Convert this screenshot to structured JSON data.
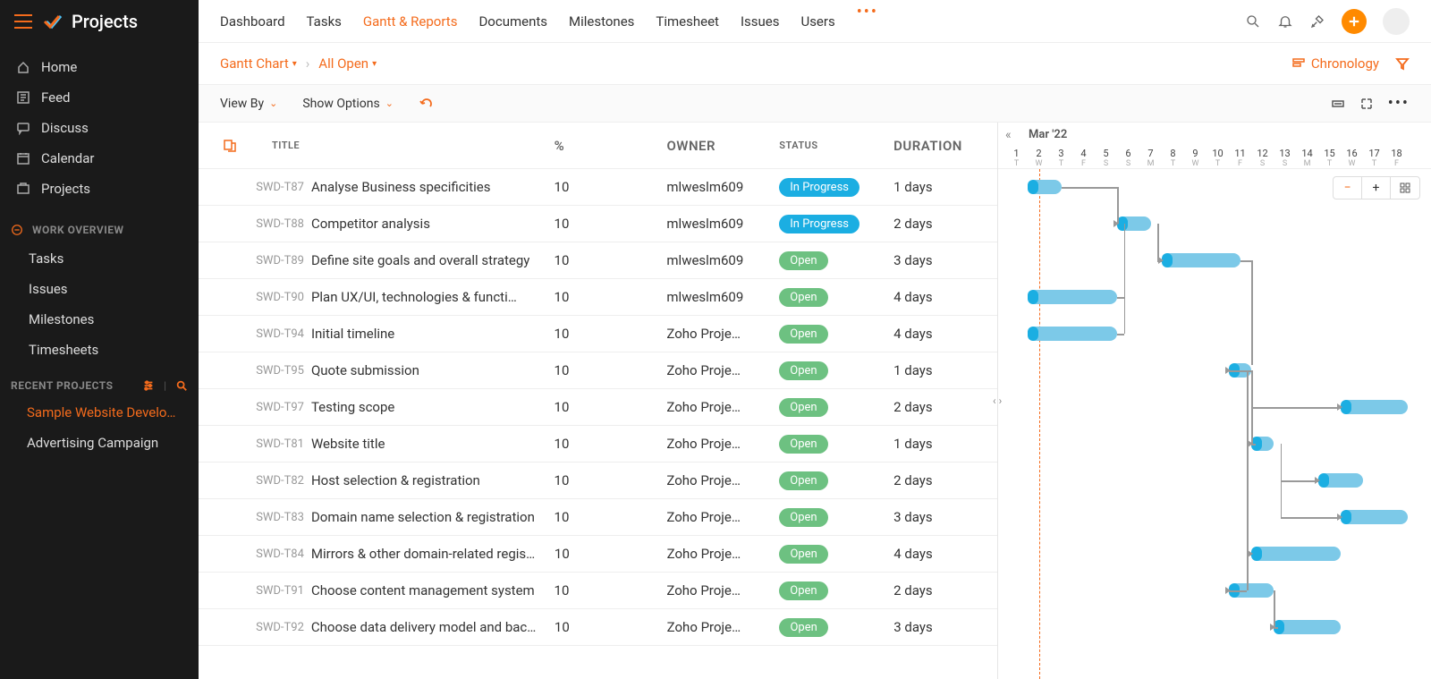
{
  "brand": "Projects",
  "sidebar": {
    "nav": [
      {
        "label": "Home",
        "icon": "home"
      },
      {
        "label": "Feed",
        "icon": "feed"
      },
      {
        "label": "Discuss",
        "icon": "discuss"
      },
      {
        "label": "Calendar",
        "icon": "calendar"
      },
      {
        "label": "Projects",
        "icon": "projects"
      }
    ],
    "work_overview_label": "WORK OVERVIEW",
    "work_items": [
      {
        "label": "Tasks"
      },
      {
        "label": "Issues"
      },
      {
        "label": "Milestones"
      },
      {
        "label": "Timesheets"
      }
    ],
    "recent_label": "RECENT PROJECTS",
    "recent": [
      {
        "label": "Sample Website Develo…",
        "active": true
      },
      {
        "label": "Advertising Campaign",
        "active": false
      }
    ]
  },
  "topnav": [
    {
      "label": "Dashboard",
      "active": false
    },
    {
      "label": "Tasks",
      "active": false
    },
    {
      "label": "Gantt & Reports",
      "active": true
    },
    {
      "label": "Documents",
      "active": false
    },
    {
      "label": "Milestones",
      "active": false
    },
    {
      "label": "Timesheet",
      "active": false
    },
    {
      "label": "Issues",
      "active": false
    },
    {
      "label": "Users",
      "active": false
    }
  ],
  "breadcrumb": {
    "a": "Gantt Chart",
    "b": "All Open"
  },
  "chronology_label": "Chronology",
  "toolbar": {
    "viewby": "View By",
    "showoptions": "Show Options"
  },
  "columns": {
    "title": "TITLE",
    "pct": "%",
    "owner": "OWNER",
    "status": "STATUS",
    "duration": "DURATION"
  },
  "gantt": {
    "month": "Mar '22",
    "days": [
      {
        "n": "1",
        "w": "T"
      },
      {
        "n": "2",
        "w": "W"
      },
      {
        "n": "3",
        "w": "T"
      },
      {
        "n": "4",
        "w": "F"
      },
      {
        "n": "5",
        "w": "S"
      },
      {
        "n": "6",
        "w": "S"
      },
      {
        "n": "7",
        "w": "M"
      },
      {
        "n": "8",
        "w": "T"
      },
      {
        "n": "9",
        "w": "W"
      },
      {
        "n": "10",
        "w": "T"
      },
      {
        "n": "11",
        "w": "F"
      },
      {
        "n": "12",
        "w": "S"
      },
      {
        "n": "13",
        "w": "S"
      },
      {
        "n": "14",
        "w": "M"
      },
      {
        "n": "15",
        "w": "T"
      },
      {
        "n": "16",
        "w": "W"
      },
      {
        "n": "17",
        "w": "T"
      },
      {
        "n": "18",
        "w": "F"
      }
    ],
    "today_col": 1
  },
  "rows": [
    {
      "id": "SWD-T87",
      "title": "Analyse Business specificities",
      "pct": "10",
      "owner": "mlweslm609",
      "status": "In Progress",
      "status_cls": "inprogress",
      "duration": "1 days",
      "bar_start": 1,
      "bar_len": 1.5
    },
    {
      "id": "SWD-T88",
      "title": "Competitor analysis",
      "pct": "10",
      "owner": "mlweslm609",
      "status": "In Progress",
      "status_cls": "inprogress",
      "duration": "2 days",
      "bar_start": 5,
      "bar_len": 1.5
    },
    {
      "id": "SWD-T89",
      "title": "Define site goals and overall strategy",
      "pct": "10",
      "owner": "mlweslm609",
      "status": "Open",
      "status_cls": "open",
      "duration": "3 days",
      "bar_start": 7,
      "bar_len": 3.5
    },
    {
      "id": "SWD-T90",
      "title": "Plan UX&#x2f;UI, technologies & functi…",
      "pct": "10",
      "owner": "mlweslm609",
      "status": "Open",
      "status_cls": "open",
      "duration": "4 days",
      "bar_start": 1,
      "bar_len": 4
    },
    {
      "id": "SWD-T94",
      "title": "Initial timeline",
      "pct": "10",
      "owner": "Zoho Proje…",
      "status": "Open",
      "status_cls": "open",
      "duration": "4 days",
      "bar_start": 1,
      "bar_len": 4
    },
    {
      "id": "SWD-T95",
      "title": "Quote submission",
      "pct": "10",
      "owner": "Zoho Proje…",
      "status": "Open",
      "status_cls": "open",
      "duration": "1 days",
      "bar_start": 10,
      "bar_len": 1
    },
    {
      "id": "SWD-T97",
      "title": "Testing scope",
      "pct": "10",
      "owner": "Zoho Proje…",
      "status": "Open",
      "status_cls": "open",
      "duration": "2 days",
      "bar_start": 15,
      "bar_len": 3
    },
    {
      "id": "SWD-T81",
      "title": "Website title",
      "pct": "10",
      "owner": "Zoho Proje…",
      "status": "Open",
      "status_cls": "open",
      "duration": "1 days",
      "bar_start": 11,
      "bar_len": 1
    },
    {
      "id": "SWD-T82",
      "title": "Host selection & registration",
      "pct": "10",
      "owner": "Zoho Proje…",
      "status": "Open",
      "status_cls": "open",
      "duration": "2 days",
      "bar_start": 14,
      "bar_len": 2
    },
    {
      "id": "SWD-T83",
      "title": "Domain name selection & registration",
      "pct": "10",
      "owner": "Zoho Proje…",
      "status": "Open",
      "status_cls": "open",
      "duration": "3 days",
      "bar_start": 15,
      "bar_len": 3
    },
    {
      "id": "SWD-T84",
      "title": "Mirrors & other domain-related registra…",
      "pct": "10",
      "owner": "Zoho Proje…",
      "status": "Open",
      "status_cls": "open",
      "duration": "4 days",
      "bar_start": 11,
      "bar_len": 4
    },
    {
      "id": "SWD-T91",
      "title": "Choose content management system",
      "pct": "10",
      "owner": "Zoho Proje…",
      "status": "Open",
      "status_cls": "open",
      "duration": "2 days",
      "bar_start": 10,
      "bar_len": 2
    },
    {
      "id": "SWD-T92",
      "title": "Choose data delivery model and backup",
      "pct": "10",
      "owner": "Zoho Proje…",
      "status": "Open",
      "status_cls": "open",
      "duration": "3 days",
      "bar_start": 12,
      "bar_len": 3
    }
  ],
  "zoom_controls": {
    "minus": "−",
    "plus": "+"
  }
}
